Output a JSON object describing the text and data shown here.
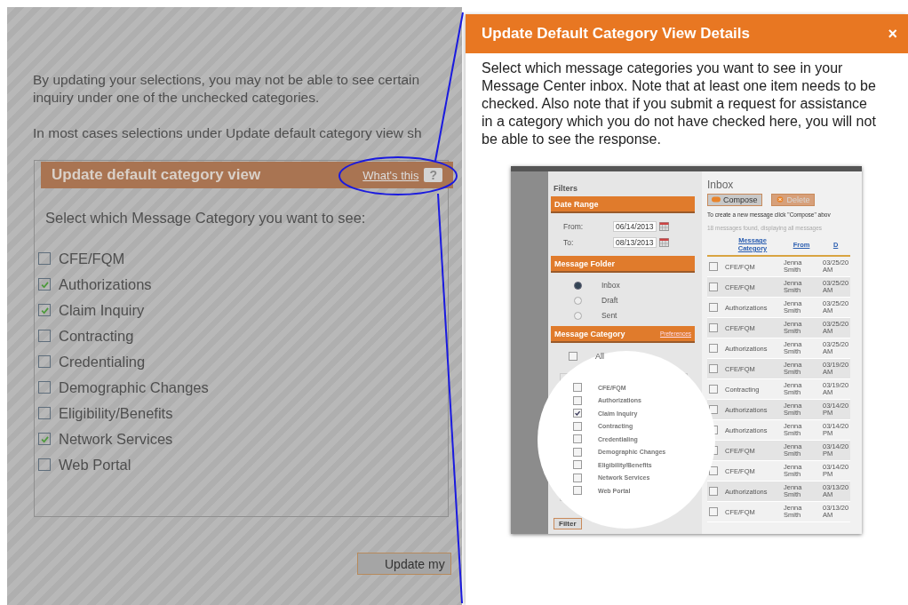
{
  "background_page": {
    "intro": "By updating your selections, you may not be able to see certain inquiry under one of the unchecked categories.",
    "note": "In most cases selections under Update default category view sh",
    "panel": {
      "title": "Update default category view",
      "help_link": "What's this",
      "help_icon": "?",
      "prompt": "Select which Message Category you want to see:",
      "categories": [
        {
          "label": "CFE/FQM",
          "checked": false
        },
        {
          "label": "Authorizations",
          "checked": true
        },
        {
          "label": "Claim Inquiry",
          "checked": true
        },
        {
          "label": "Contracting",
          "checked": false
        },
        {
          "label": "Credentialing",
          "checked": false
        },
        {
          "label": "Demographic Changes",
          "checked": false
        },
        {
          "label": "Eligibility/Benefits",
          "checked": false
        },
        {
          "label": "Network Services",
          "checked": true
        },
        {
          "label": "Web Portal",
          "checked": false
        }
      ]
    },
    "button": "Update my"
  },
  "modal": {
    "title": "Update Default Category View Details",
    "close": "×",
    "description": "Select which message categories you want to see in your Message Center inbox. Note that at least one item needs to be checked. Also note that if you submit a request for assistance in a category which you do not have checked here, you will not be able to see the response.",
    "screenshot": {
      "filters": {
        "title": "Filters",
        "date_range": {
          "header": "Date Range",
          "from_label": "From:",
          "from": "06/14/2013",
          "to_label": "To:",
          "to": "08/13/2013"
        },
        "folder": {
          "header": "Message Folder",
          "options": [
            {
              "label": "Inbox",
              "selected": true
            },
            {
              "label": "Draft",
              "selected": false
            },
            {
              "label": "Sent",
              "selected": false
            }
          ]
        },
        "category": {
          "header": "Message Category",
          "link": "Preferences",
          "all": {
            "label": "All",
            "checked": false
          },
          "items": [
            {
              "label": "CFE/FQM",
              "checked": false
            },
            {
              "label": "Authorizations",
              "checked": false
            },
            {
              "label": "Claim Inquiry",
              "checked": true
            },
            {
              "label": "Contracting",
              "checked": false
            },
            {
              "label": "Credentialing",
              "checked": false
            },
            {
              "label": "Demographic Changes",
              "checked": false
            },
            {
              "label": "Eligibility/Benefits",
              "checked": false
            },
            {
              "label": "Network Services",
              "checked": false
            },
            {
              "label": "Web Portal",
              "checked": false
            }
          ]
        },
        "button": "Filter"
      },
      "inbox": {
        "title": "Inbox",
        "buttons": [
          {
            "label": "Compose",
            "kind": "compose",
            "disabled": false
          },
          {
            "label": "Delete",
            "kind": "delete",
            "disabled": true
          }
        ],
        "hint": "To create a new message click \"Compose\" abov",
        "count": "18 messages found, displaying all messages",
        "columns": [
          "Message Category",
          "From",
          "D"
        ],
        "rows": [
          {
            "category": "CFE/FQM",
            "from": "Jenna Smith",
            "date": "03/25/20 AM",
            "checked": false
          },
          {
            "category": "CFE/FQM",
            "from": "Jenna Smith",
            "date": "03/25/20 AM",
            "checked": false
          },
          {
            "category": "Authorizations",
            "from": "Jenna Smith",
            "date": "03/25/20 AM",
            "checked": false
          },
          {
            "category": "CFE/FQM",
            "from": "Jenna Smith",
            "date": "03/25/20 AM",
            "checked": false
          },
          {
            "category": "Authorizations",
            "from": "Jenna Smith",
            "date": "03/25/20 AM",
            "checked": false
          },
          {
            "category": "CFE/FQM",
            "from": "Jenna Smith",
            "date": "03/19/20 AM",
            "checked": false
          },
          {
            "category": "Contracting",
            "from": "Jenna Smith",
            "date": "03/19/20 AM",
            "checked": false
          },
          {
            "category": "Authorizations",
            "from": "Jenna Smith",
            "date": "03/14/20 PM",
            "checked": false
          },
          {
            "category": "Authorizations",
            "from": "Jenna Smith",
            "date": "03/14/20 PM",
            "checked": false
          },
          {
            "category": "CFE/FQM",
            "from": "Jenna Smith",
            "date": "03/14/20 PM",
            "checked": false
          },
          {
            "category": "CFE/FQM",
            "from": "Jenna Smith",
            "date": "03/14/20 PM",
            "checked": false
          },
          {
            "category": "Authorizations",
            "from": "Jenna Smith",
            "date": "03/13/20 AM",
            "checked": false
          },
          {
            "category": "CFE/FQM",
            "from": "Jenna Smith",
            "date": "03/13/20 AM",
            "checked": false
          }
        ]
      }
    }
  }
}
